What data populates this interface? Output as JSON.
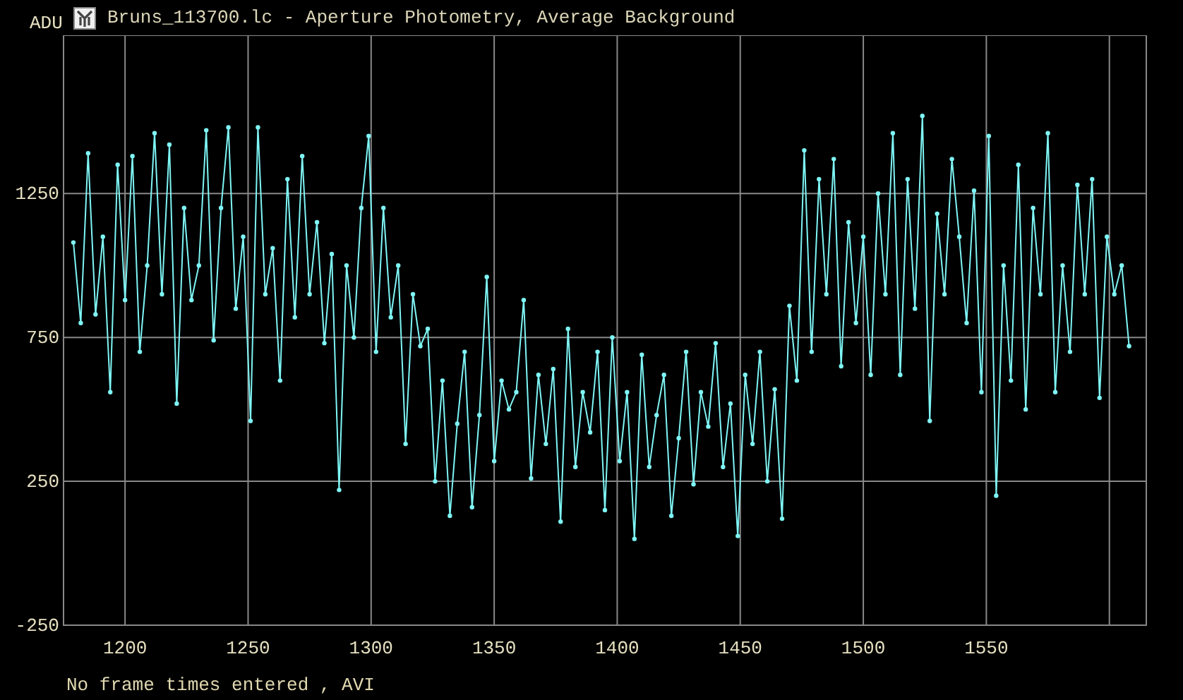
{
  "window": {
    "title": "Bruns_113700.lc - Aperture Photometry, Average Background"
  },
  "plot": {
    "chart_data": {
      "type": "line",
      "ylabel": "ADU",
      "grid": true,
      "xlim": [
        1175,
        1615
      ],
      "ylim": [
        -250,
        1800
      ],
      "xticks": [
        1200,
        1250,
        1300,
        1350,
        1400,
        1450,
        1500,
        1550
      ],
      "yticks": [
        -250,
        250,
        750,
        1250
      ],
      "x": [
        1179,
        1182,
        1185,
        1188,
        1191,
        1194,
        1197,
        1200,
        1203,
        1206,
        1209,
        1212,
        1215,
        1218,
        1221,
        1224,
        1227,
        1230,
        1233,
        1236,
        1239,
        1242,
        1245,
        1248,
        1251,
        1254,
        1257,
        1260,
        1263,
        1266,
        1269,
        1272,
        1275,
        1278,
        1281,
        1284,
        1287,
        1290,
        1293,
        1296,
        1299,
        1302,
        1305,
        1308,
        1311,
        1314,
        1317,
        1320,
        1323,
        1326,
        1329,
        1332,
        1335,
        1338,
        1341,
        1344,
        1347,
        1350,
        1353,
        1356,
        1359,
        1362,
        1365,
        1368,
        1371,
        1374,
        1377,
        1380,
        1383,
        1386,
        1389,
        1392,
        1395,
        1398,
        1401,
        1404,
        1407,
        1410,
        1413,
        1416,
        1419,
        1422,
        1425,
        1428,
        1431,
        1434,
        1437,
        1440,
        1443,
        1446,
        1449,
        1452,
        1455,
        1458,
        1461,
        1464,
        1467,
        1470,
        1473,
        1476,
        1479,
        1482,
        1485,
        1488,
        1491,
        1494,
        1497,
        1500,
        1503,
        1506,
        1509,
        1512,
        1515,
        1518,
        1521,
        1524,
        1527,
        1530,
        1533,
        1536,
        1539,
        1542,
        1545,
        1548,
        1551,
        1554,
        1557,
        1560,
        1563,
        1566,
        1569,
        1572,
        1575,
        1578,
        1581,
        1584,
        1587,
        1590,
        1593,
        1596,
        1599,
        1602,
        1605,
        1608
      ],
      "series": [
        {
          "color": "#7ff5f5",
          "marker": "o",
          "values": [
            1080,
            800,
            1390,
            830,
            1100,
            560,
            1350,
            880,
            1380,
            700,
            1000,
            1460,
            900,
            1420,
            520,
            1200,
            880,
            1000,
            1470,
            740,
            1200,
            1480,
            850,
            1100,
            460,
            1480,
            900,
            1060,
            600,
            1300,
            820,
            1380,
            900,
            1150,
            730,
            1040,
            220,
            1000,
            750,
            1200,
            1450,
            700,
            1200,
            820,
            1000,
            380,
            900,
            720,
            780,
            250,
            600,
            130,
            450,
            700,
            160,
            480,
            960,
            320,
            600,
            500,
            560,
            880,
            260,
            620,
            380,
            640,
            110,
            780,
            300,
            560,
            420,
            700,
            150,
            750,
            320,
            560,
            50,
            690,
            300,
            480,
            620,
            130,
            400,
            700,
            240,
            560,
            440,
            730,
            300,
            520,
            60,
            620,
            380,
            700,
            250,
            570,
            120,
            860,
            600,
            1400,
            700,
            1300,
            900,
            1370,
            650,
            1150,
            800,
            1100,
            620,
            1250,
            900,
            1460,
            620,
            1300,
            850,
            1520,
            460,
            1180,
            900,
            1370,
            1100,
            800,
            1260,
            560,
            1450,
            200,
            1000,
            600,
            1350,
            500,
            1200,
            900,
            1460,
            560,
            1000,
            700,
            1280,
            900,
            1300,
            540,
            1100,
            900,
            1000,
            720
          ]
        }
      ]
    }
  },
  "status_bar": {
    "text": "No frame times entered , AVI"
  }
}
